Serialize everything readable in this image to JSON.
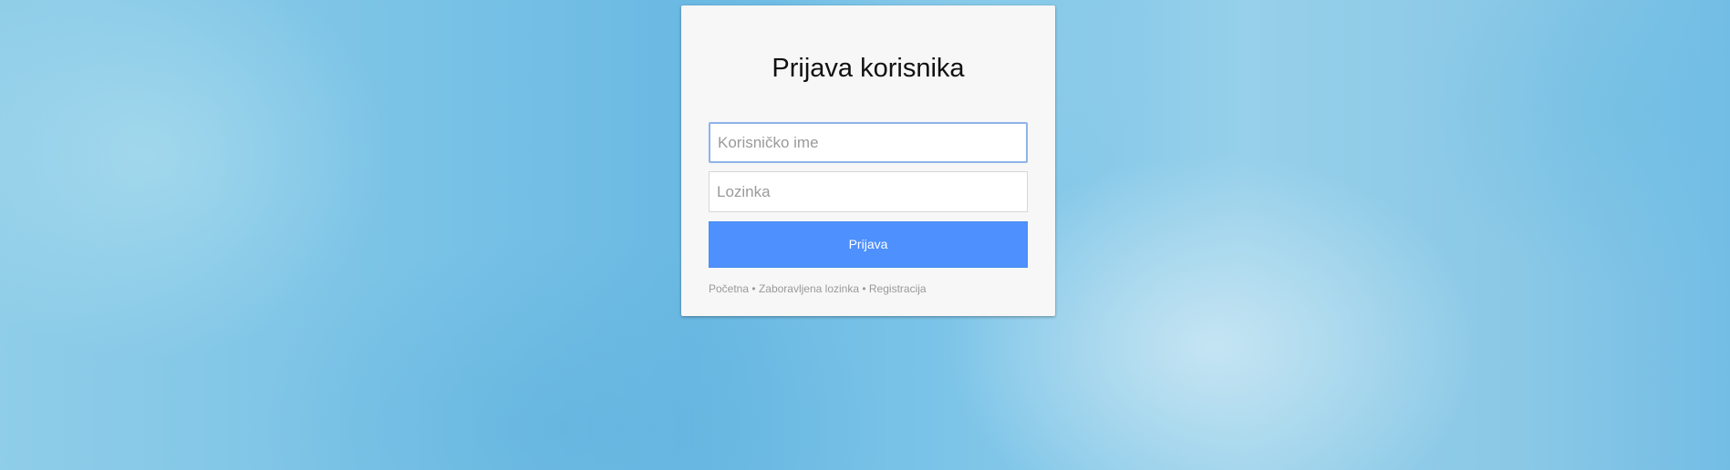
{
  "login": {
    "title": "Prijava korisnika",
    "username_placeholder": "Korisničko ime",
    "username_value": "",
    "password_placeholder": "Lozinka",
    "password_value": "",
    "submit_label": "Prijava"
  },
  "footer_links": {
    "home": "Početna",
    "forgot_password": "Zaboravljena lozinka",
    "register": "Registracija",
    "separator": "•"
  },
  "colors": {
    "button": "#4d90fe",
    "card": "#f7f7f7",
    "focus_border": "#8fb3ea"
  }
}
